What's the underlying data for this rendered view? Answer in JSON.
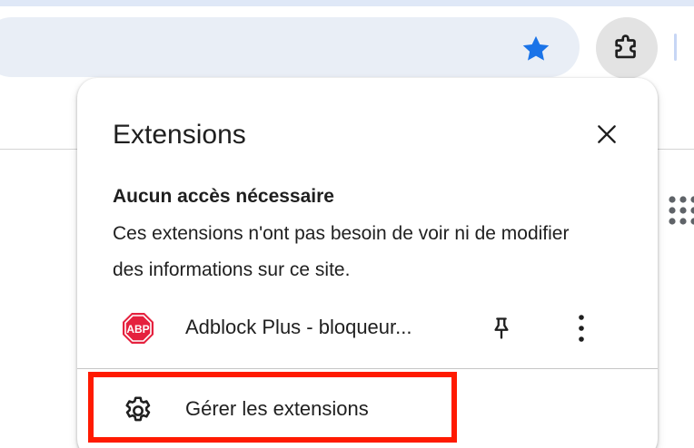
{
  "toolbar": {
    "bookmark_icon": "star-icon",
    "extensions_icon": "puzzle-icon",
    "accent_color": "#1a73e8"
  },
  "popup": {
    "title": "Extensions",
    "close_icon": "close-icon",
    "section_title": "Aucun accès nécessaire",
    "section_description": "Ces extensions n'ont pas besoin de voir ni de modifier des informations sur ce site.",
    "extensions": [
      {
        "icon_label": "ABP",
        "name": "Adblock Plus - bloqueur...",
        "icon_color": "#e5213e"
      }
    ],
    "manage_label": "Gérer les extensions"
  },
  "highlight_color": "#ff1a00"
}
